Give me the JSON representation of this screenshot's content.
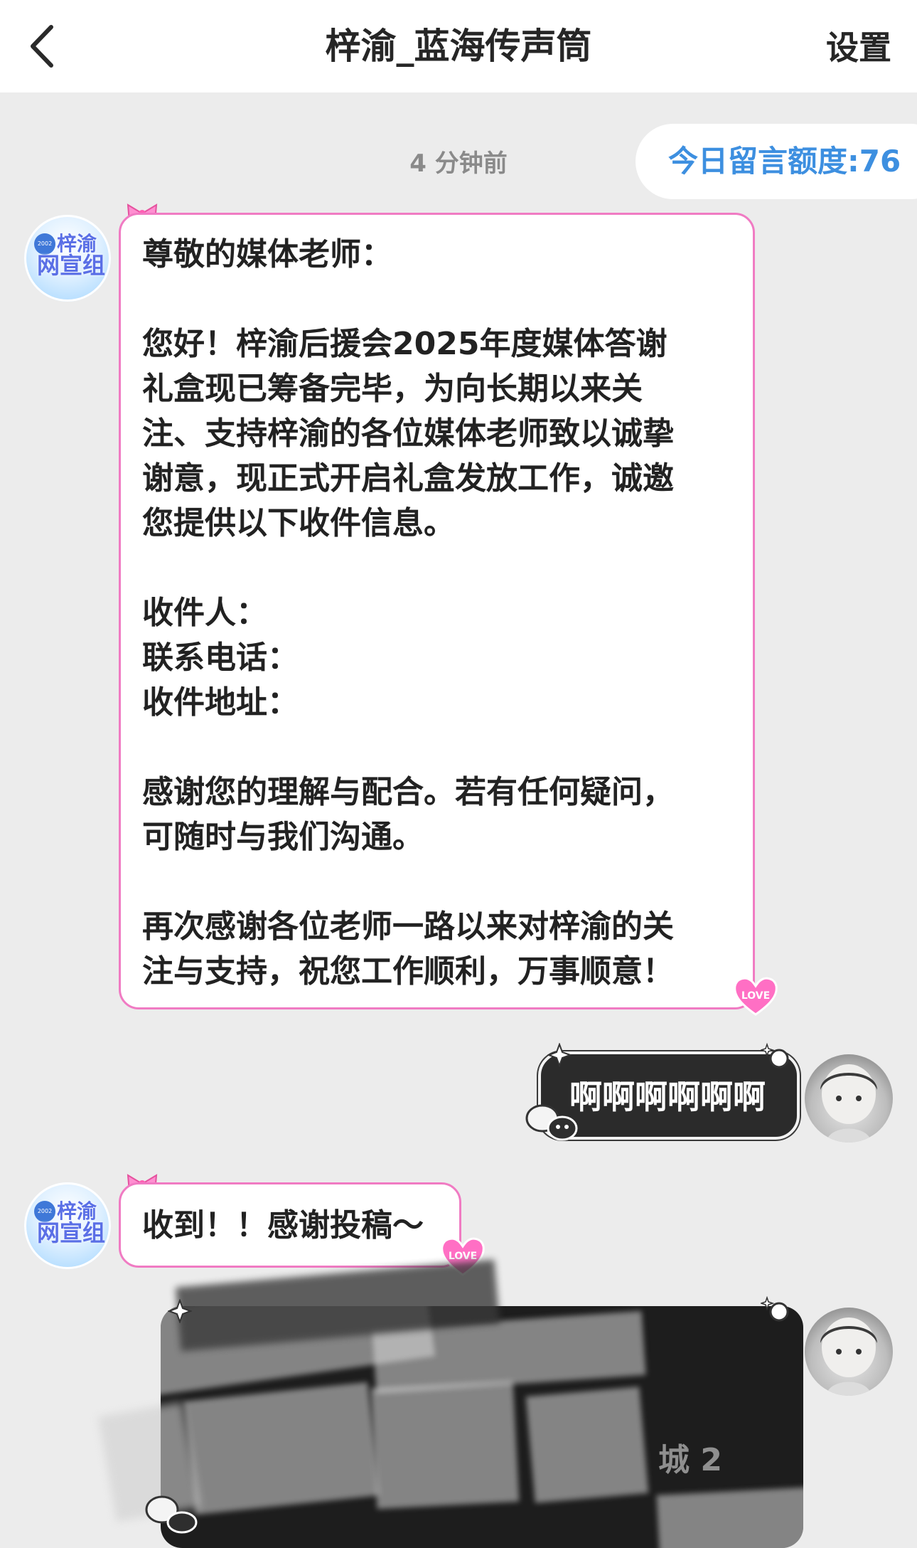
{
  "header": {
    "back_icon": "chevron-left-icon",
    "title": "梓渝_蓝海传声筒",
    "settings_label": "设置"
  },
  "timestamp": "4 分钟前",
  "quota_label": "今日留言额度:76",
  "org_avatar": {
    "text_top": "梓渝",
    "text_bottom": "网宣组",
    "badge": "2002"
  },
  "messages": [
    {
      "sender": "org",
      "paragraphs": [
        [
          "尊敬的媒体老师："
        ],
        [
          "您好！梓渝后援会2025年度媒体答谢",
          "礼盒现已筹备完毕，为向长期以来关",
          "注、支持梓渝的各位媒体老师致以诚挚",
          "谢意，现正式开启礼盒发放工作，诚邀",
          "您提供以下收件信息。"
        ],
        [
          "收件人：",
          "联系电话：",
          "收件地址："
        ],
        [
          "感谢您的理解与配合。若有任何疑问，",
          "可随时与我们沟通。"
        ],
        [
          "再次感谢各位老师一路以来对梓渝的关",
          "注与支持，祝您工作顺利，万事顺意！"
        ]
      ]
    },
    {
      "sender": "user",
      "text": "啊啊啊啊啊啊"
    },
    {
      "sender": "org",
      "text": "收到！！感谢投稿～"
    },
    {
      "sender": "user",
      "redacted_visible_text": "城 2"
    }
  ],
  "decorations": {
    "bow_icon": "pink-bow-icon",
    "love_heart_icon": "love-heart-sticker-icon",
    "love_text": "LOVE",
    "sparkle_icon": "sparkle-icon",
    "mascot_icon": "mascot-sticker-icon"
  },
  "colors": {
    "pink_border": "#f07bc3",
    "quota_blue": "#3d8fe0",
    "dark_bubble": "#2b2b2b",
    "background": "#ececec"
  }
}
